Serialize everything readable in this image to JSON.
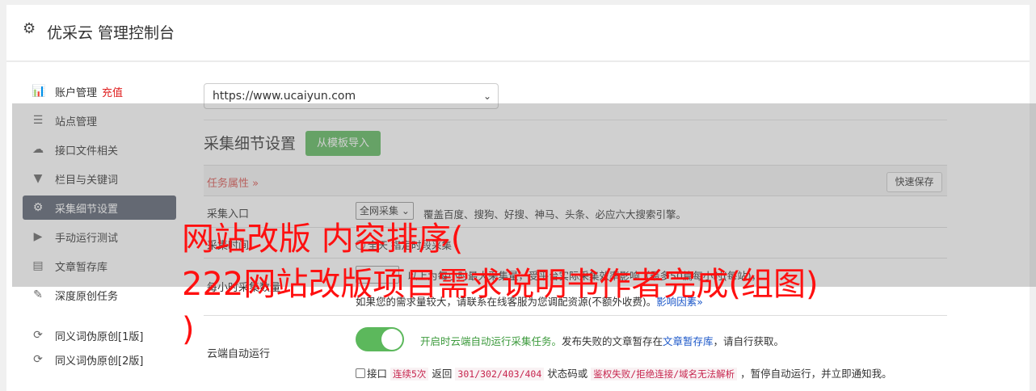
{
  "header": {
    "title": "优采云 管理控制台",
    "icon": "gear-icon"
  },
  "sidebar": {
    "items": [
      {
        "label": "账户管理",
        "extra": "充值",
        "icon": "bar-chart-icon",
        "glyph": "📊"
      },
      {
        "label": "站点管理",
        "icon": "server-icon",
        "glyph": "☰"
      },
      {
        "label": "接口文件相关",
        "icon": "cloud-upload-icon",
        "glyph": "☁"
      },
      {
        "label": "栏目与关键词",
        "icon": "filter-icon",
        "glyph": "▼"
      },
      {
        "label": "采集细节设置",
        "icon": "cogs-icon",
        "glyph": "⚙",
        "active": true
      },
      {
        "label": "手动运行测试",
        "icon": "play-circle-icon",
        "glyph": "▶"
      },
      {
        "label": "文章暂存库",
        "icon": "database-icon",
        "glyph": "▤"
      },
      {
        "label": "深度原创任务",
        "icon": "edit-icon",
        "glyph": "✎"
      },
      {
        "label": "同义词伪原创[1版]",
        "icon": "refresh-icon",
        "glyph": "⟳"
      },
      {
        "label": "同义词伪原创[2版]",
        "icon": "refresh-icon",
        "glyph": "⟳"
      }
    ]
  },
  "site_select": {
    "value": "https://www.ucaiyun.com"
  },
  "section": {
    "title": "采集细节设置",
    "import_button": "从模板导入"
  },
  "table": {
    "task_attr": "任务属性 »",
    "quick_save": "快速保存",
    "row_entry": {
      "label": "采集入口",
      "select": "全网采集",
      "desc": "覆盖百度、搜狗、好搜、神马、头条、必应六大搜索引擎。"
    },
    "row_time": {
      "label": "采集时间",
      "desc": "全天  指定时段采集"
    },
    "row_amount": {
      "label": "每小时采集数量",
      "desc": "以上为每小时最大采集量，受平台实际采集效率影响（最多50篇每小时(每站)，",
      "desc2": "如果您的需求量较大，请联系在线客服为您调配资源(不额外收费)。",
      "link": "影响因素»"
    },
    "row_cloud": {
      "label": "云端自动运行",
      "toggle_on": true,
      "status_green": "开启时云端自动运行采集任务。",
      "status_rest": "发布失败的文章暂存在",
      "status_link": "文章暂存库",
      "status_end": "，请自行获取。",
      "chk_label": "接口",
      "code1": "连续5次",
      "t1": "返回",
      "code2": "301/302/403/404",
      "t2": "状态码或",
      "code3": "鉴权失败/拒绝连接/域名无法解析",
      "t3": "，暂停自动运行，并立即通知我。"
    }
  },
  "banner": {
    "line1": "网站改版 内容排序(",
    "line2": "222网站改版项目需求说明书作者完成(组图)",
    "line3": ")",
    "color": "#ff1010"
  }
}
